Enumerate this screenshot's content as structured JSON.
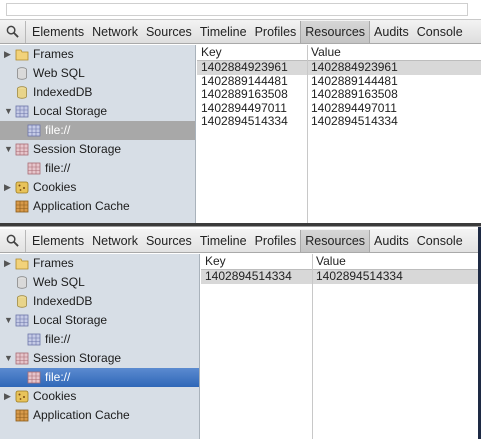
{
  "tabs": [
    "Elements",
    "Network",
    "Sources",
    "Timeline",
    "Profiles",
    "Resources",
    "Audits",
    "Console"
  ],
  "selected_tab": "Resources",
  "sidebar": {
    "frames": "Frames",
    "web_sql": "Web SQL",
    "indexeddb": "IndexedDB",
    "local_storage": "Local Storage",
    "local_storage_child": "file://",
    "session_storage": "Session Storage",
    "session_storage_child": "file://",
    "cookies": "Cookies",
    "application_cache": "Application Cache"
  },
  "grid_headers": {
    "key": "Key",
    "value": "Value"
  },
  "top_panel": {
    "selected_item": "Local Storage / file://",
    "rows": [
      {
        "key": "1402884923961",
        "value": "1402884923961"
      },
      {
        "key": "1402889144481",
        "value": "1402889144481"
      },
      {
        "key": "1402889163508",
        "value": "1402889163508"
      },
      {
        "key": "1402894497011",
        "value": "1402894497011"
      },
      {
        "key": "1402894514334",
        "value": "1402894514334"
      }
    ]
  },
  "bottom_panel": {
    "selected_item": "Session Storage / file://",
    "rows": [
      {
        "key": "1402894514334",
        "value": "1402894514334"
      }
    ]
  },
  "colors": {
    "sidebar_bg": "#d7dee6",
    "selected_gray": "#a8a8a8",
    "selected_blue": "#3a72c0"
  }
}
